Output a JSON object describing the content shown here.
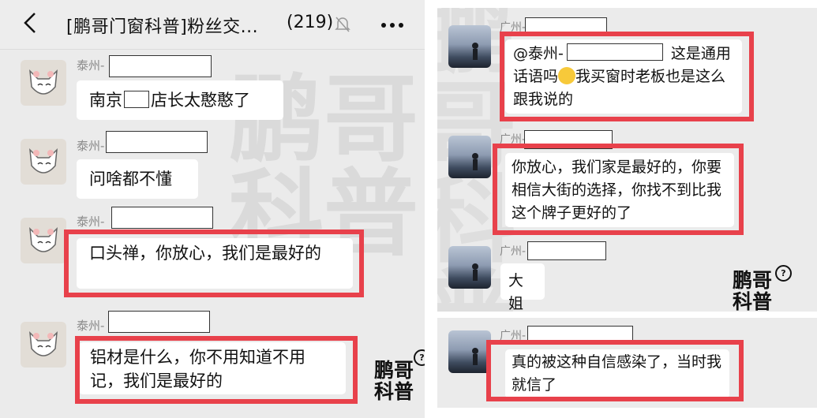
{
  "header": {
    "title": "[鹏哥门窗科普]粉丝交...",
    "member_count": "(219)"
  },
  "watermark_text": "鹏哥科普",
  "left_messages": [
    {
      "sender": "泰州-",
      "text": [
        "南京",
        "店长太憨憨了"
      ]
    },
    {
      "sender": "泰州-",
      "text": "问啥都不懂"
    },
    {
      "sender": "泰州-",
      "text": "口头禅，你放心，我们是最好的"
    },
    {
      "sender": "泰州-",
      "text": "铝材是什么，你不用知道不用记，我们是最好的"
    }
  ],
  "right_messages": [
    {
      "sender": "广州-",
      "mention": "@泰州-",
      "text_a": " 这是通用话语吗",
      "text_b": "我买窗时老板也是这么跟我说的",
      "emoji": "grinning-sweat-emoji"
    },
    {
      "sender": "广州-",
      "text": "你放心，我们家是最好的，你要相信大街的选择，你找不到比我这个牌子更好的了"
    },
    {
      "sender": "广州-",
      "text": "大姐"
    },
    {
      "sender": "广州-",
      "text": "真的被这种自信感染了，当时我就信了"
    }
  ],
  "logo": {
    "line1": "鹏哥",
    "line2": "科普",
    "badge": "?"
  },
  "colors": {
    "highlight": "#e8414b",
    "chat_bg": "#ebebeb",
    "bubble": "#ffffff"
  }
}
